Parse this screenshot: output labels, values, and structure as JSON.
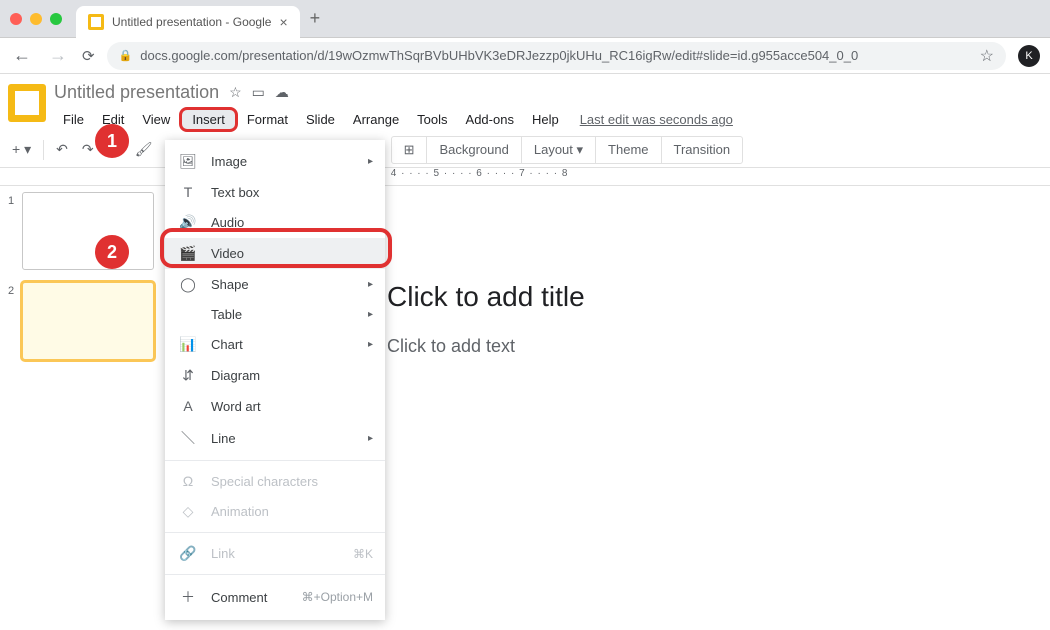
{
  "browser": {
    "tab_title": "Untitled presentation - Google",
    "url_display": "docs.google.com/presentation/d/19wOzmwThSqrBVbUHbVK3eDRJezzp0jkUHu_RC16igRw/edit#slide=id.g955acce504_0_0",
    "avatar_letter": "K"
  },
  "app": {
    "doc_title": "Untitled presentation",
    "menus": [
      "File",
      "Edit",
      "View",
      "Insert",
      "Format",
      "Slide",
      "Arrange",
      "Tools",
      "Add-ons",
      "Help"
    ],
    "open_menu": "Insert",
    "last_edit": "Last edit was seconds ago"
  },
  "toolbar": {
    "buttons": [
      "Background",
      "Layout",
      "Theme",
      "Transition"
    ]
  },
  "dropdown": {
    "items": [
      {
        "icon": "🖼",
        "label": "Image",
        "submenu": true
      },
      {
        "icon": "T",
        "label": "Text box"
      },
      {
        "icon": "🔊",
        "label": "Audio"
      },
      {
        "icon": "🎬",
        "label": "Video",
        "highlight": true
      },
      {
        "icon": "◯",
        "label": "Shape",
        "submenu": true
      },
      {
        "icon": "",
        "label": "Table",
        "submenu": true
      },
      {
        "icon": "📊",
        "label": "Chart",
        "submenu": true
      },
      {
        "icon": "⇵",
        "label": "Diagram"
      },
      {
        "icon": "A",
        "label": "Word art"
      },
      {
        "icon": "＼",
        "label": "Line",
        "submenu": true
      },
      {
        "sep": true
      },
      {
        "icon": "Ω",
        "label": "Special characters",
        "disabled": true
      },
      {
        "icon": "◇",
        "label": "Animation",
        "disabled": true
      },
      {
        "sep": true
      },
      {
        "icon": "🔗",
        "label": "Link",
        "shortcut": "⌘K",
        "disabled": true
      },
      {
        "sep": true
      },
      {
        "icon": "＋",
        "label": "Comment",
        "shortcut": "⌘+Option+M"
      }
    ]
  },
  "slide": {
    "title_placeholder": "Click to add title",
    "text_placeholder": "Click to add text"
  },
  "ruler": {
    "marks": "· · · · 1 · · · · 2 · · · · 3 · · · · 4 · · · · 5 · · · · 6 · · · · 7 · · · · 8"
  },
  "annotations": {
    "badge1": "1",
    "badge2": "2"
  }
}
